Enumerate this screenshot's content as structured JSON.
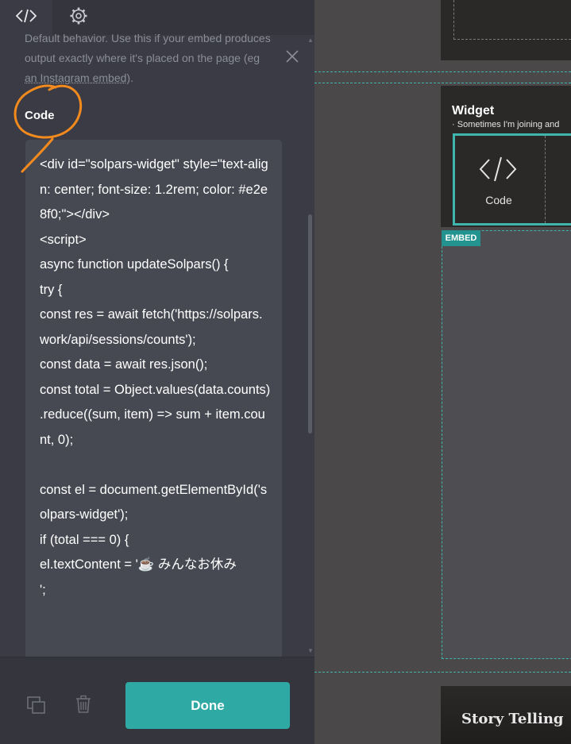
{
  "editor": {
    "tabs": [
      {
        "icon": "code-icon"
      },
      {
        "icon": "gear-icon"
      }
    ],
    "help": {
      "line1": "Default behavior. Use this if your embed produces",
      "line2": "output exactly where it's placed on the page (eg",
      "line3_link": "an Instagram embed",
      "line3_end": ")."
    },
    "code_label": "Code",
    "code_value": "<div id=\"solpars-widget\" style=\"text-align: center; font-size: 1.2rem; color: #e2e8f0;\"></div>\n<script>\nasync function updateSolpars() {\ntry {\nconst res = await fetch('https://solpars.work/api/sessions/counts');\nconst data = await res.json();\nconst total = Object.values(data.counts)\n.reduce((sum, item) => sum + item.count, 0);\n\nconst el = document.getElementById('solpars-widget');\nif (total === 0) {\nel.textContent = '☕ みんなお休み\n';",
    "done_label": "Done"
  },
  "canvas": {
    "widget_title": "Widget",
    "widget_subtitle": "Sometimes I'm joining and",
    "widget_code_label": "Code",
    "embed_badge": "EMBED",
    "story_title": "Story Telling"
  },
  "colors": {
    "accent": "#2fa9a3",
    "annotation": "#f28a1e",
    "panel_bg": "#3a3b44"
  }
}
